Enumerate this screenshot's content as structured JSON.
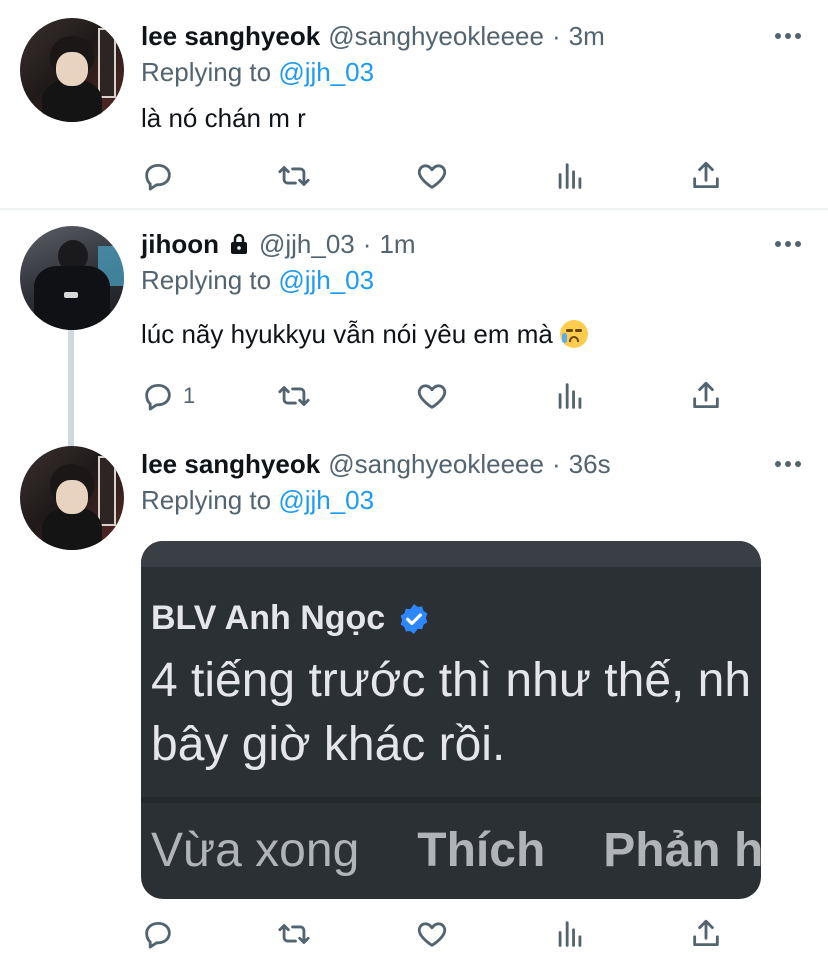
{
  "tweets": [
    {
      "author_name": "lee sanghyeok",
      "handle": "@sanghyeokleeee",
      "dot": "·",
      "time": "3m",
      "replying_label": "Replying to",
      "replying_to": "@jjh_03",
      "text": "là nó chán m r",
      "reply_count": ""
    },
    {
      "author_name": "jihoon",
      "handle": "@jjh_03",
      "dot": "·",
      "time": "1m",
      "replying_label": "Replying to",
      "replying_to": "@jjh_03",
      "text": "lúc nãy hyukkyu vẫn nói yêu em mà",
      "emoji": "loudly-crying-face",
      "locked": true,
      "reply_count": "1"
    },
    {
      "author_name": "lee sanghyeok",
      "handle": "@sanghyeokleeee",
      "dot": "·",
      "time": "36s",
      "replying_label": "Replying to",
      "replying_to": "@jjh_03",
      "reply_count": "",
      "media": {
        "commenter": "BLV Anh Ngọc",
        "quote_line1": "4 tiếng trước thì như thế, nh",
        "quote_line2": "bây giờ khác rồi.",
        "footer_time": "Vừa xong",
        "footer_like": "Thích",
        "footer_reply": "Phản hồ"
      }
    }
  ],
  "icons": [
    "reply-icon",
    "retweet-icon",
    "like-icon",
    "analytics-icon",
    "share-icon",
    "more-icon",
    "lock-icon",
    "verified-icon"
  ],
  "colors": {
    "accent": "#1d9bf0",
    "secondary_text": "#536471",
    "primary_text": "#0f1419"
  }
}
